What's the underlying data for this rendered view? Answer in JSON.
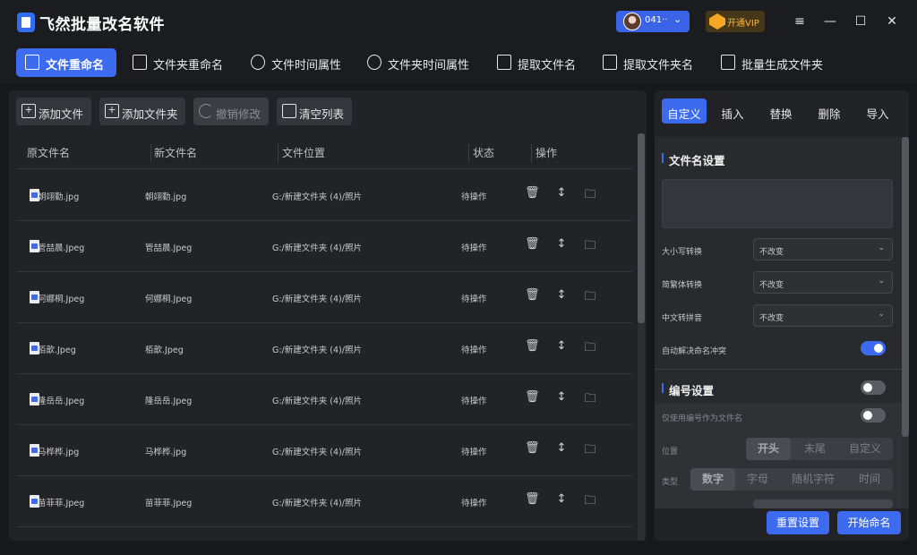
{
  "app": {
    "title": "飞然批量改名软件"
  },
  "header": {
    "user_name": "041··",
    "vip_label": "开通VIP",
    "menu_glyph": "≡",
    "min_glyph": "—",
    "max_glyph": "☐",
    "close_glyph": "✕"
  },
  "tabs": [
    {
      "label": "文件重命名",
      "icon": "file-rename-icon",
      "active": true
    },
    {
      "label": "文件夹重命名",
      "icon": "terminal-icon"
    },
    {
      "label": "文件时间属性",
      "icon": "clock-file-icon"
    },
    {
      "label": "文件夹时间属性",
      "icon": "clock-folder-icon"
    },
    {
      "label": "提取文件名",
      "icon": "extract-file-icon"
    },
    {
      "label": "提取文件夹名",
      "icon": "upload-file-icon"
    },
    {
      "label": "批量生成文件夹",
      "icon": "gear-file-icon"
    }
  ],
  "toolbar": {
    "add_file": "添加文件",
    "add_folder": "添加文件夹",
    "undo": "撤销修改",
    "clear": "清空列表"
  },
  "table": {
    "headers": [
      "原文件名",
      "新文件名",
      "文件位置",
      "状态",
      "操作"
    ],
    "rows": [
      {
        "orig": "朝翊勤.jpg",
        "new": "朝翊勤.jpg",
        "path": "G:/新建文件夹 (4)/照片",
        "status": "待操作"
      },
      {
        "orig": "管喆晨.Jpeg",
        "new": "管喆晨.Jpeg",
        "path": "G:/新建文件夹 (4)/照片",
        "status": "待操作"
      },
      {
        "orig": "何娜桐.Jpeg",
        "new": "何娜桐.Jpeg",
        "path": "G:/新建文件夹 (4)/照片",
        "status": "待操作"
      },
      {
        "orig": "栢歆.Jpeg",
        "new": "栢歆.Jpeg",
        "path": "G:/新建文件夹 (4)/照片",
        "status": "待操作"
      },
      {
        "orig": "隆岳岳.Jpeg",
        "new": "隆岳岳.Jpeg",
        "path": "G:/新建文件夹 (4)/照片",
        "status": "待操作"
      },
      {
        "orig": "马桦桦.jpg",
        "new": "马桦桦.jpg",
        "path": "G:/新建文件夹 (4)/照片",
        "status": "待操作"
      },
      {
        "orig": "苗菲菲.Jpeg",
        "new": "苗菲菲.Jpeg",
        "path": "G:/新建文件夹 (4)/照片",
        "status": "待操作"
      }
    ]
  },
  "right": {
    "tabs": [
      "自定义",
      "插入",
      "替换",
      "删除",
      "导入"
    ],
    "filename_section": "文件名设置",
    "case_label": "大小写转换",
    "case_value": "不改变",
    "trad_label": "简繁体转换",
    "trad_value": "不改变",
    "pinyin_label": "中文转拼音",
    "pinyin_value": "不改变",
    "autoresolve_label": "自动解决命名冲突",
    "numbering_section": "编号设置",
    "only_number_label": "仅使用编号作为文件名",
    "position_label": "位置",
    "position_options": [
      "开头",
      "末尾",
      "自定义"
    ],
    "type_label": "类型",
    "type_options": [
      "数字",
      "字母",
      "随机字符",
      "时间"
    ],
    "reset_button": "重置设置",
    "start_button": "开始命名"
  },
  "colors": {
    "accent": "#3c6bf0",
    "vip": "#f5a623",
    "panel": "#222327"
  }
}
